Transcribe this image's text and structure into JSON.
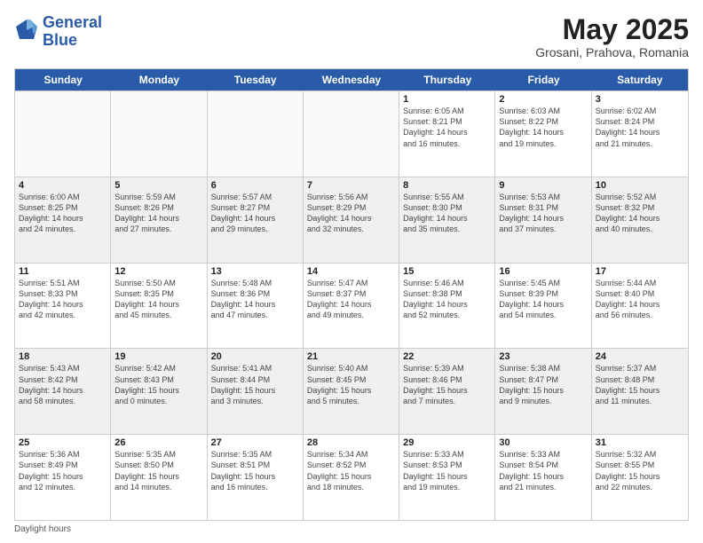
{
  "header": {
    "logo_line1": "General",
    "logo_line2": "Blue",
    "month": "May 2025",
    "location": "Grosani, Prahova, Romania"
  },
  "days_of_week": [
    "Sunday",
    "Monday",
    "Tuesday",
    "Wednesday",
    "Thursday",
    "Friday",
    "Saturday"
  ],
  "footer": {
    "note": "Daylight hours"
  },
  "weeks": [
    [
      {
        "day": "",
        "info": ""
      },
      {
        "day": "",
        "info": ""
      },
      {
        "day": "",
        "info": ""
      },
      {
        "day": "",
        "info": ""
      },
      {
        "day": "1",
        "info": "Sunrise: 6:05 AM\nSunset: 8:21 PM\nDaylight: 14 hours\nand 16 minutes."
      },
      {
        "day": "2",
        "info": "Sunrise: 6:03 AM\nSunset: 8:22 PM\nDaylight: 14 hours\nand 19 minutes."
      },
      {
        "day": "3",
        "info": "Sunrise: 6:02 AM\nSunset: 8:24 PM\nDaylight: 14 hours\nand 21 minutes."
      }
    ],
    [
      {
        "day": "4",
        "info": "Sunrise: 6:00 AM\nSunset: 8:25 PM\nDaylight: 14 hours\nand 24 minutes."
      },
      {
        "day": "5",
        "info": "Sunrise: 5:59 AM\nSunset: 8:26 PM\nDaylight: 14 hours\nand 27 minutes."
      },
      {
        "day": "6",
        "info": "Sunrise: 5:57 AM\nSunset: 8:27 PM\nDaylight: 14 hours\nand 29 minutes."
      },
      {
        "day": "7",
        "info": "Sunrise: 5:56 AM\nSunset: 8:29 PM\nDaylight: 14 hours\nand 32 minutes."
      },
      {
        "day": "8",
        "info": "Sunrise: 5:55 AM\nSunset: 8:30 PM\nDaylight: 14 hours\nand 35 minutes."
      },
      {
        "day": "9",
        "info": "Sunrise: 5:53 AM\nSunset: 8:31 PM\nDaylight: 14 hours\nand 37 minutes."
      },
      {
        "day": "10",
        "info": "Sunrise: 5:52 AM\nSunset: 8:32 PM\nDaylight: 14 hours\nand 40 minutes."
      }
    ],
    [
      {
        "day": "11",
        "info": "Sunrise: 5:51 AM\nSunset: 8:33 PM\nDaylight: 14 hours\nand 42 minutes."
      },
      {
        "day": "12",
        "info": "Sunrise: 5:50 AM\nSunset: 8:35 PM\nDaylight: 14 hours\nand 45 minutes."
      },
      {
        "day": "13",
        "info": "Sunrise: 5:48 AM\nSunset: 8:36 PM\nDaylight: 14 hours\nand 47 minutes."
      },
      {
        "day": "14",
        "info": "Sunrise: 5:47 AM\nSunset: 8:37 PM\nDaylight: 14 hours\nand 49 minutes."
      },
      {
        "day": "15",
        "info": "Sunrise: 5:46 AM\nSunset: 8:38 PM\nDaylight: 14 hours\nand 52 minutes."
      },
      {
        "day": "16",
        "info": "Sunrise: 5:45 AM\nSunset: 8:39 PM\nDaylight: 14 hours\nand 54 minutes."
      },
      {
        "day": "17",
        "info": "Sunrise: 5:44 AM\nSunset: 8:40 PM\nDaylight: 14 hours\nand 56 minutes."
      }
    ],
    [
      {
        "day": "18",
        "info": "Sunrise: 5:43 AM\nSunset: 8:42 PM\nDaylight: 14 hours\nand 58 minutes."
      },
      {
        "day": "19",
        "info": "Sunrise: 5:42 AM\nSunset: 8:43 PM\nDaylight: 15 hours\nand 0 minutes."
      },
      {
        "day": "20",
        "info": "Sunrise: 5:41 AM\nSunset: 8:44 PM\nDaylight: 15 hours\nand 3 minutes."
      },
      {
        "day": "21",
        "info": "Sunrise: 5:40 AM\nSunset: 8:45 PM\nDaylight: 15 hours\nand 5 minutes."
      },
      {
        "day": "22",
        "info": "Sunrise: 5:39 AM\nSunset: 8:46 PM\nDaylight: 15 hours\nand 7 minutes."
      },
      {
        "day": "23",
        "info": "Sunrise: 5:38 AM\nSunset: 8:47 PM\nDaylight: 15 hours\nand 9 minutes."
      },
      {
        "day": "24",
        "info": "Sunrise: 5:37 AM\nSunset: 8:48 PM\nDaylight: 15 hours\nand 11 minutes."
      }
    ],
    [
      {
        "day": "25",
        "info": "Sunrise: 5:36 AM\nSunset: 8:49 PM\nDaylight: 15 hours\nand 12 minutes."
      },
      {
        "day": "26",
        "info": "Sunrise: 5:35 AM\nSunset: 8:50 PM\nDaylight: 15 hours\nand 14 minutes."
      },
      {
        "day": "27",
        "info": "Sunrise: 5:35 AM\nSunset: 8:51 PM\nDaylight: 15 hours\nand 16 minutes."
      },
      {
        "day": "28",
        "info": "Sunrise: 5:34 AM\nSunset: 8:52 PM\nDaylight: 15 hours\nand 18 minutes."
      },
      {
        "day": "29",
        "info": "Sunrise: 5:33 AM\nSunset: 8:53 PM\nDaylight: 15 hours\nand 19 minutes."
      },
      {
        "day": "30",
        "info": "Sunrise: 5:33 AM\nSunset: 8:54 PM\nDaylight: 15 hours\nand 21 minutes."
      },
      {
        "day": "31",
        "info": "Sunrise: 5:32 AM\nSunset: 8:55 PM\nDaylight: 15 hours\nand 22 minutes."
      }
    ]
  ]
}
